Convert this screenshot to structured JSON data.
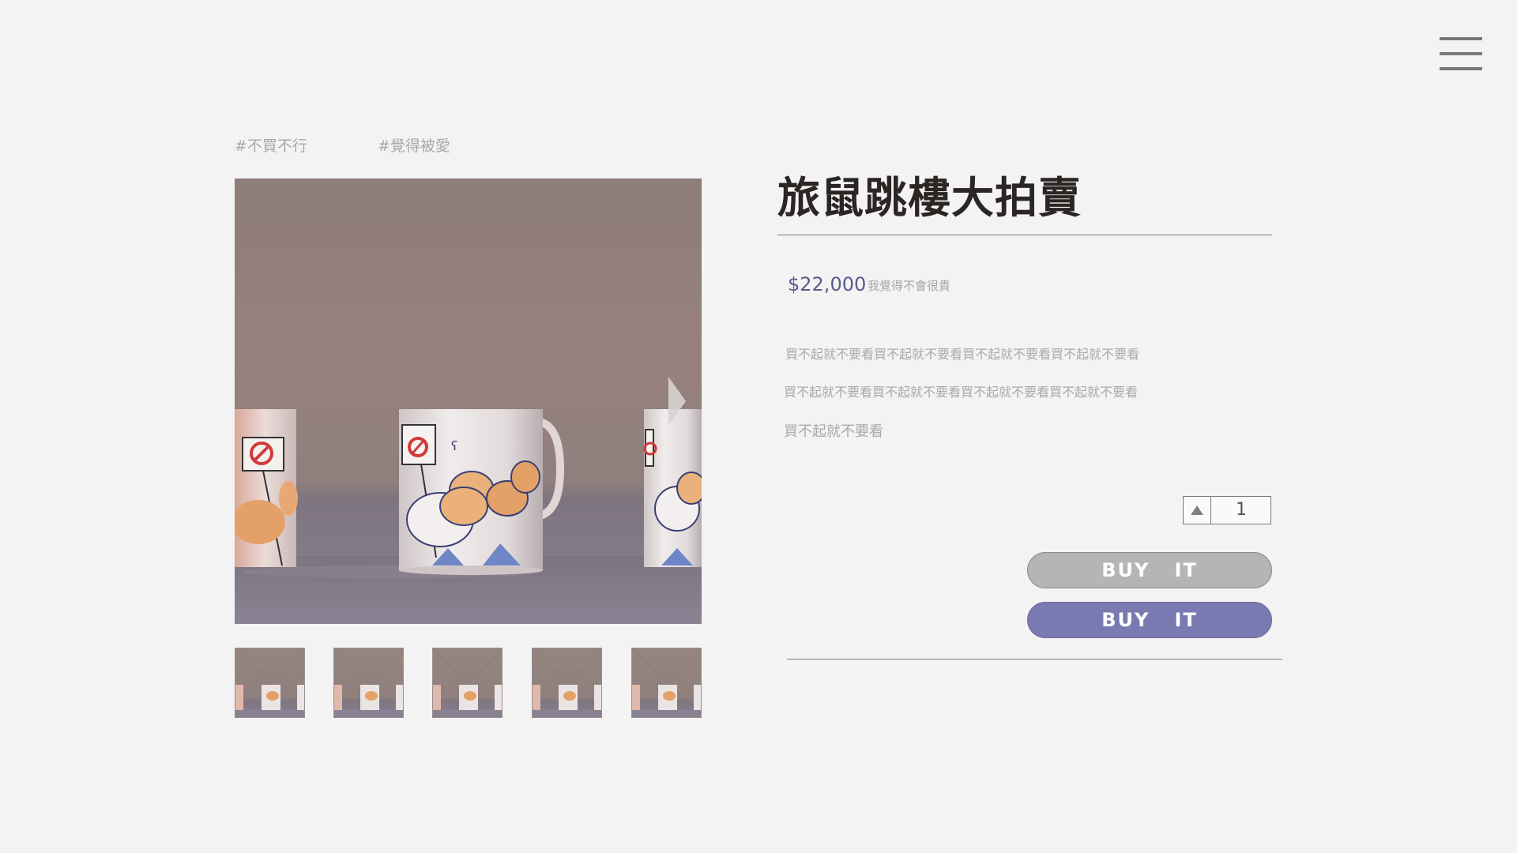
{
  "menu": {
    "icon": "hamburger-menu-icon"
  },
  "tags": [
    "#不買不行",
    "#覺得被愛"
  ],
  "product": {
    "title": "旅鼠跳樓大拍賣",
    "price": "$22,000",
    "price_note": "我覺得不會很貴",
    "description": [
      "買不起就不要看買不起就不要看買不起就不要看買不起就不要看",
      "買不起就不要看買不起就不要看買不起就不要看買不起就不要看",
      "買不起就不要看"
    ]
  },
  "gallery": {
    "main_image": "hamster-mug-photo",
    "next_icon": "chevron-right-icon",
    "thumbnail_count": 5
  },
  "quantity": {
    "value": "1",
    "increment_icon": "triangle-up-icon"
  },
  "buttons": {
    "buy_gray_label": "BUY   IT",
    "buy_purple_label": "BUY   IT"
  },
  "colors": {
    "background": "#f3f3f3",
    "accent_purple": "#7a7ab3",
    "price_text": "#5b5a8d",
    "button_gray": "#b5b5b5",
    "title_text": "#2b2524"
  }
}
